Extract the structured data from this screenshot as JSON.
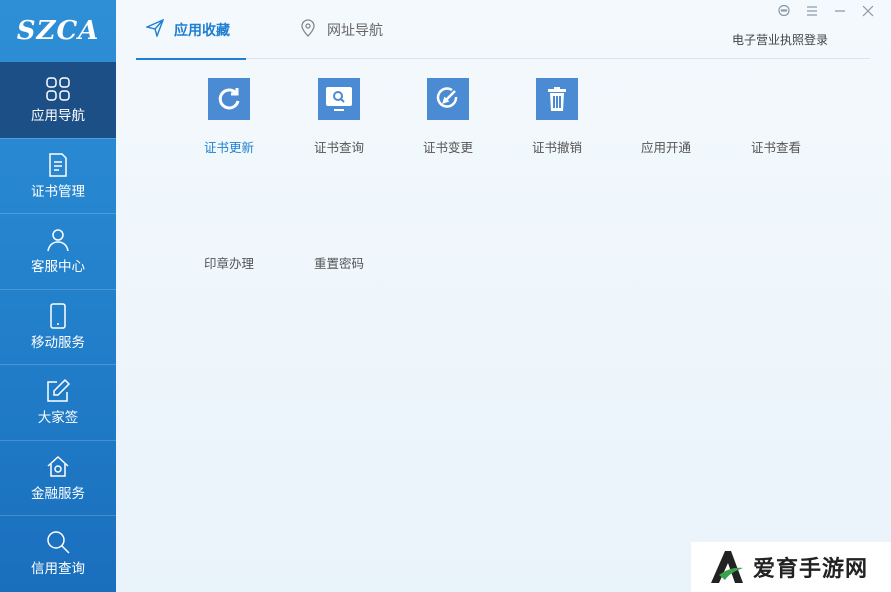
{
  "logo": {
    "text": "SZCA"
  },
  "sidebar": {
    "items": [
      {
        "label": "应用导航",
        "icon": "grid-icon",
        "active": true
      },
      {
        "label": "证书管理",
        "icon": "document-icon"
      },
      {
        "label": "客服中心",
        "icon": "user-icon"
      },
      {
        "label": "移动服务",
        "icon": "phone-icon"
      },
      {
        "label": "大家签",
        "icon": "edit-icon"
      },
      {
        "label": "金融服务",
        "icon": "home-icon"
      },
      {
        "label": "信用查询",
        "icon": "search-icon"
      }
    ]
  },
  "tabs": [
    {
      "label": "应用收藏",
      "icon": "send-icon",
      "active": true
    },
    {
      "label": "网址导航",
      "icon": "location-icon"
    }
  ],
  "header": {
    "license_login": "电子营业执照登录"
  },
  "window_controls": [
    "feedback-icon",
    "menu-icon",
    "minimize-icon",
    "close-icon"
  ],
  "apps": [
    {
      "label": "证书更新",
      "icon": "refresh-icon"
    },
    {
      "label": "证书查询",
      "icon": "monitor-search-icon"
    },
    {
      "label": "证书变更",
      "icon": "change-icon"
    },
    {
      "label": "证书撤销",
      "icon": "trash-icon"
    },
    {
      "label": "应用开通",
      "icon": ""
    },
    {
      "label": "证书查看",
      "icon": ""
    },
    {
      "label": "印章办理",
      "icon": ""
    },
    {
      "label": "重置密码",
      "icon": ""
    }
  ],
  "watermark": {
    "text": "爱育手游网"
  },
  "colors": {
    "sidebar": "#2381cc",
    "sidebar_active": "#1c4f86",
    "accent": "#1f7fd0",
    "icon_bg": "#4b8bd3"
  }
}
